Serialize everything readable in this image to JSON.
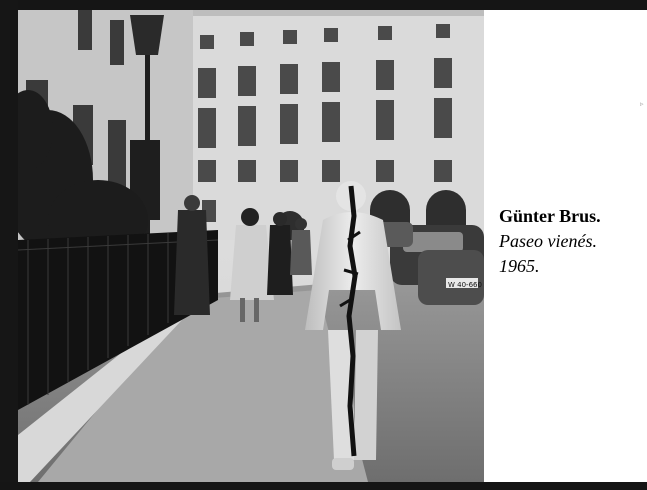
{
  "caption": {
    "artist": "Günter Brus.",
    "title": "Paseo vienés.",
    "year": "1965."
  },
  "photo": {
    "subject": "black-and-white photograph",
    "plate": "W 40-660"
  },
  "colors": {
    "slide_background": "#ffffff",
    "frame": "#141414",
    "caption_text": "#000000"
  }
}
